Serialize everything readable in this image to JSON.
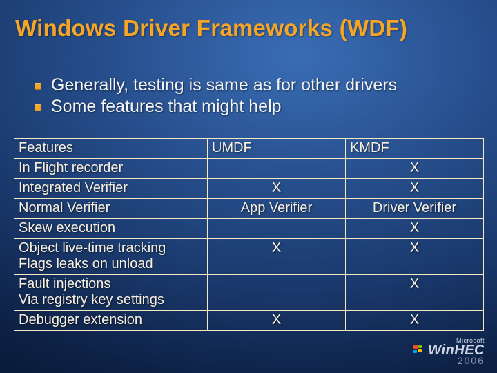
{
  "title": "Windows Driver Frameworks (WDF)",
  "bullets": [
    "Generally, testing is same as for other drivers",
    "Some features that might help"
  ],
  "table": {
    "headers": [
      "Features",
      "UMDF",
      "KMDF"
    ],
    "rows": [
      {
        "feature": "In Flight recorder",
        "umdf": "",
        "kmdf": "X"
      },
      {
        "feature": "Integrated Verifier",
        "umdf": "X",
        "kmdf": "X"
      },
      {
        "feature": "Normal Verifier",
        "umdf": "App Verifier",
        "kmdf": "Driver Verifier"
      },
      {
        "feature": "Skew execution",
        "umdf": "",
        "kmdf": "X"
      },
      {
        "feature": "Object live-time tracking",
        "feature_sub": "Flags leaks on unload",
        "umdf": "X",
        "kmdf": "X"
      },
      {
        "feature": "Fault injections",
        "feature_sub": "Via registry key settings",
        "umdf": "",
        "kmdf": "X"
      },
      {
        "feature": "Debugger extension",
        "umdf": "X",
        "kmdf": "X"
      }
    ]
  },
  "logo": {
    "company": "Microsoft",
    "brand": "WinHEC",
    "year": "2006"
  },
  "chart_data": {
    "type": "table",
    "title": "Windows Driver Frameworks feature matrix",
    "columns": [
      "Features",
      "UMDF",
      "KMDF"
    ],
    "rows": [
      [
        "In Flight recorder",
        "",
        "X"
      ],
      [
        "Integrated Verifier",
        "X",
        "X"
      ],
      [
        "Normal Verifier",
        "App Verifier",
        "Driver Verifier"
      ],
      [
        "Skew execution",
        "",
        "X"
      ],
      [
        "Object live-time tracking — Flags leaks on unload",
        "X",
        "X"
      ],
      [
        "Fault injections — Via registry key settings",
        "",
        "X"
      ],
      [
        "Debugger extension",
        "X",
        "X"
      ]
    ]
  }
}
